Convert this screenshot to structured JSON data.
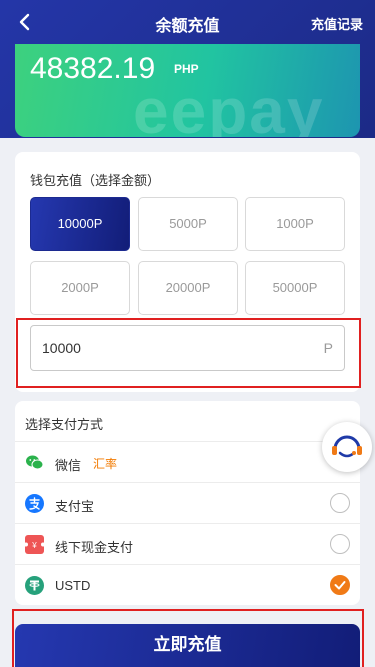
{
  "header": {
    "back_icon": "chevron-left-icon",
    "title": "余额充值",
    "history_link": "充值记录"
  },
  "balance": {
    "amount": "48382.19",
    "currency": "PHP",
    "watermark": "eepay"
  },
  "recharge": {
    "section_label": "钱包充值（选择金额）",
    "amounts": [
      "10000P",
      "5000P",
      "1000P",
      "2000P",
      "20000P",
      "50000P"
    ],
    "selected_amount": "10000P",
    "input_value": "10000",
    "input_unit": "P"
  },
  "payment": {
    "section_label": "选择支付方式",
    "methods": [
      {
        "label": "微信",
        "extra": "汇率",
        "icon": "wechat-icon",
        "selected": false
      },
      {
        "label": "支付宝",
        "icon": "alipay-icon",
        "selected": false
      },
      {
        "label": "线下现金支付",
        "icon": "cash-ticket-icon",
        "selected": false
      },
      {
        "label": "USTD",
        "icon": "tether-icon",
        "selected": true
      }
    ]
  },
  "service": {
    "icon": "customer-service-icon"
  },
  "submit": {
    "label": "立即充值"
  },
  "colors": {
    "primary": "#1c2a90",
    "accent": "#f07a16",
    "highlight_border": "#e02020",
    "card_green": "#3dd17e"
  }
}
